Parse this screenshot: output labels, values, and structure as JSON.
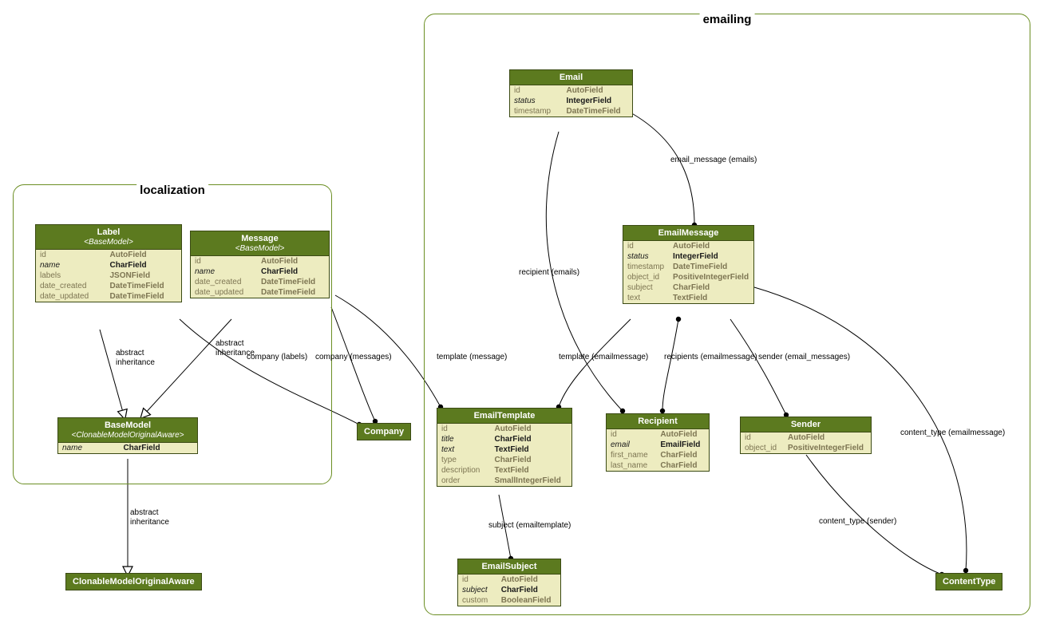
{
  "packages": {
    "localization": {
      "title": "localization"
    },
    "emailing": {
      "title": "emailing"
    }
  },
  "classes": {
    "Label": {
      "name": "Label",
      "stereo": "<BaseModel>",
      "fields": [
        {
          "name": "id",
          "type": "AutoField",
          "required": false
        },
        {
          "name": "name",
          "type": "CharField",
          "required": true
        },
        {
          "name": "labels",
          "type": "JSONField",
          "required": false
        },
        {
          "name": "date_created",
          "type": "DateTimeField",
          "required": false
        },
        {
          "name": "date_updated",
          "type": "DateTimeField",
          "required": false
        }
      ]
    },
    "Message": {
      "name": "Message",
      "stereo": "<BaseModel>",
      "fields": [
        {
          "name": "id",
          "type": "AutoField",
          "required": false
        },
        {
          "name": "name",
          "type": "CharField",
          "required": true
        },
        {
          "name": "date_created",
          "type": "DateTimeField",
          "required": false
        },
        {
          "name": "date_updated",
          "type": "DateTimeField",
          "required": false
        }
      ]
    },
    "BaseModel": {
      "name": "BaseModel",
      "stereo": "<ClonableModelOriginalAware>",
      "fields": [
        {
          "name": "name",
          "type": "CharField",
          "required": true
        }
      ]
    },
    "ClonableModelOriginalAware": {
      "name": "ClonableModelOriginalAware"
    },
    "Company": {
      "name": "Company"
    },
    "Email": {
      "name": "Email",
      "fields": [
        {
          "name": "id",
          "type": "AutoField",
          "required": false
        },
        {
          "name": "status",
          "type": "IntegerField",
          "required": true
        },
        {
          "name": "timestamp",
          "type": "DateTimeField",
          "required": false
        }
      ]
    },
    "EmailMessage": {
      "name": "EmailMessage",
      "fields": [
        {
          "name": "id",
          "type": "AutoField",
          "required": false
        },
        {
          "name": "status",
          "type": "IntegerField",
          "required": true
        },
        {
          "name": "timestamp",
          "type": "DateTimeField",
          "required": false
        },
        {
          "name": "object_id",
          "type": "PositiveIntegerField",
          "required": false
        },
        {
          "name": "subject",
          "type": "CharField",
          "required": false
        },
        {
          "name": "text",
          "type": "TextField",
          "required": false
        }
      ]
    },
    "EmailTemplate": {
      "name": "EmailTemplate",
      "fields": [
        {
          "name": "id",
          "type": "AutoField",
          "required": false
        },
        {
          "name": "title",
          "type": "CharField",
          "required": true
        },
        {
          "name": "text",
          "type": "TextField",
          "required": true
        },
        {
          "name": "type",
          "type": "CharField",
          "required": false
        },
        {
          "name": "description",
          "type": "TextField",
          "required": false
        },
        {
          "name": "order",
          "type": "SmallIntegerField",
          "required": false
        }
      ]
    },
    "Recipient": {
      "name": "Recipient",
      "fields": [
        {
          "name": "id",
          "type": "AutoField",
          "required": false
        },
        {
          "name": "email",
          "type": "EmailField",
          "required": true
        },
        {
          "name": "first_name",
          "type": "CharField",
          "required": false
        },
        {
          "name": "last_name",
          "type": "CharField",
          "required": false
        }
      ]
    },
    "Sender": {
      "name": "Sender",
      "fields": [
        {
          "name": "id",
          "type": "AutoField",
          "required": false
        },
        {
          "name": "object_id",
          "type": "PositiveIntegerField",
          "required": false
        }
      ]
    },
    "EmailSubject": {
      "name": "EmailSubject",
      "fields": [
        {
          "name": "id",
          "type": "AutoField",
          "required": false
        },
        {
          "name": "subject",
          "type": "CharField",
          "required": true
        },
        {
          "name": "custom",
          "type": "BooleanField",
          "required": false
        }
      ]
    },
    "ContentType": {
      "name": "ContentType"
    }
  },
  "edges": {
    "label_base": "abstract\ninheritance",
    "message_base": "abstract\ninheritance",
    "base_clonable": "abstract\ninheritance",
    "company_labels": "company (labels)",
    "company_messages": "company (messages)",
    "template_message": "template (message)",
    "email_message_emails": "email_message (emails)",
    "recipient_emails": "recipient (emails)",
    "template_emailmessage": "template (emailmessage)",
    "recipients_emailmessage": "recipients (emailmessage)",
    "sender_email_messages": "sender (email_messages)",
    "content_type_emailmessage": "content_type (emailmessage)",
    "content_type_sender": "content_type (sender)",
    "subject_emailtemplate": "subject (emailtemplate)"
  }
}
